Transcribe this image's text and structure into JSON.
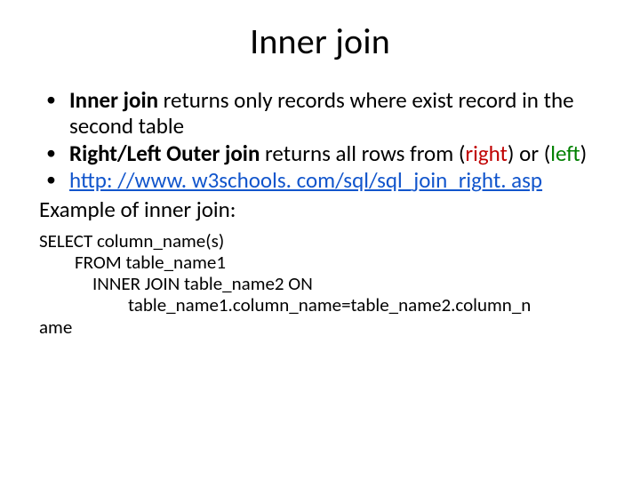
{
  "title": "Inner join",
  "bullets": {
    "b1_bold": "Inner join",
    "b1_rest": " returns only records where exist record in the second table",
    "b2_bold": "Right/Left Outer join",
    "b2_mid": " returns all rows from (",
    "b2_right": "right",
    "b2_sep": ") or  (",
    "b2_left": "left",
    "b2_end": ")",
    "b3_link": "http: //www. w3schools. com/sql/sql_join_right. asp"
  },
  "example_label": "Example of inner join:",
  "code": {
    "l1": "SELECT column_name(s)",
    "l2": "FROM table_name1",
    "l3": "INNER JOIN table_name2 ON",
    "l4": "table_name1.column_name=table_name2.column_n",
    "l5": "ame"
  }
}
